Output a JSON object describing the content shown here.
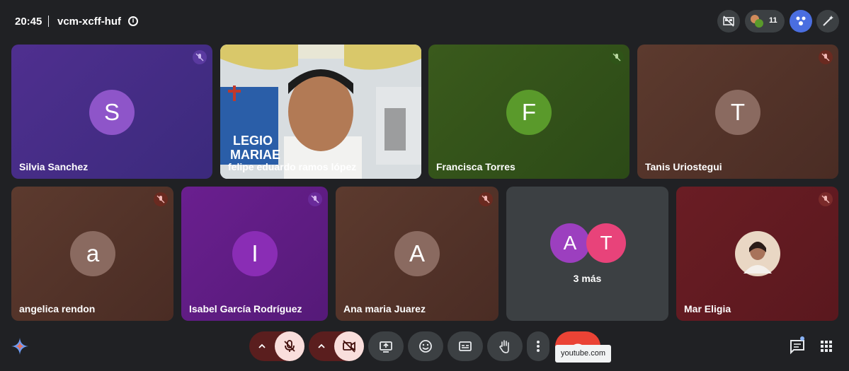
{
  "header": {
    "time": "20:45",
    "meeting_code": "vcm-xcff-huf",
    "people_count": "11"
  },
  "participants": [
    {
      "name": "Silvia Sanchez",
      "initial": "S",
      "avatar_color": "#8e55c9"
    },
    {
      "name": "felipe eduardo ramos lópez",
      "initial": "",
      "avatar_color": ""
    },
    {
      "name": "Francisca Torres",
      "initial": "F",
      "avatar_color": "#5a9a2b"
    },
    {
      "name": "Tanis Uriostegui",
      "initial": "T",
      "avatar_color": "#8a6a60"
    },
    {
      "name": "angelica rendon",
      "initial": "a",
      "avatar_color": "#8a6a60"
    },
    {
      "name": "Isabel García Rodríguez",
      "initial": "I",
      "avatar_color": "#8a2db5"
    },
    {
      "name": "Ana maria Juarez",
      "initial": "A",
      "avatar_color": "#8a6a60"
    },
    {
      "name": "Mar Eligia",
      "initial": "",
      "avatar_color": ""
    }
  ],
  "more_tile": {
    "initials": [
      "A",
      "T"
    ],
    "label": "3 más"
  },
  "video_background_text": {
    "line1": "LEGIO",
    "line2": "MARIAE"
  },
  "tooltip": "youtube.com",
  "icons": {
    "info": "info-icon",
    "hide_tiles": "hide-tiles-icon",
    "people": "people-icon",
    "activities": "activities-icon",
    "effects": "effects-icon",
    "gemini": "gemini-icon",
    "mic": "mic-off-icon",
    "camera": "camera-off-icon",
    "present": "present-icon",
    "emoji": "emoji-icon",
    "captions": "captions-icon",
    "hand": "raise-hand-icon",
    "more": "more-options-icon",
    "end_call": "end-call-icon",
    "chat": "chat-icon",
    "apps": "apps-grid-icon"
  },
  "colors": {
    "background": "#202124",
    "mic_muted": "#f9dedc",
    "end_call": "#ea4335",
    "control": "#3c4043"
  }
}
